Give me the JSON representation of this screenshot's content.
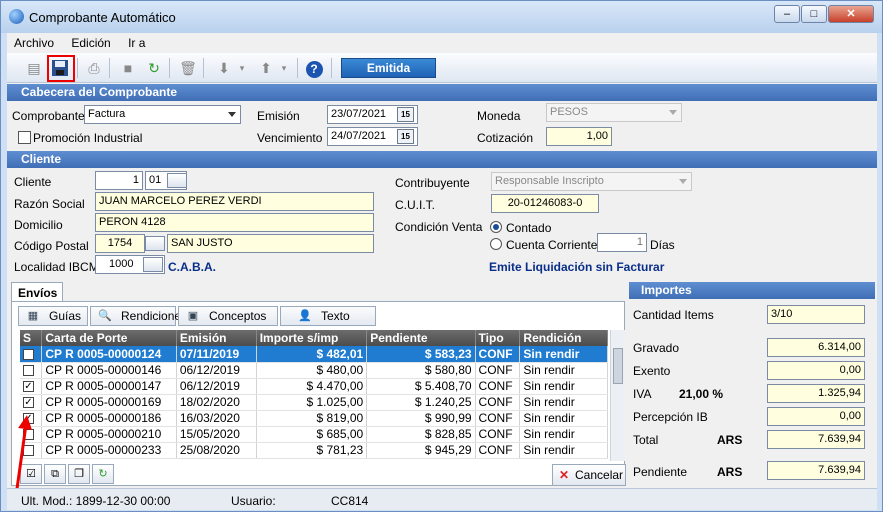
{
  "window": {
    "title": "Comprobante Automático",
    "minimize": "–",
    "maximize": "□",
    "close": "✕"
  },
  "menu": [
    "Archivo",
    "Edición",
    "Ir a"
  ],
  "toolbar": {
    "status": "Emitida",
    "help": "?"
  },
  "cabecera": {
    "header": "Cabecera del Comprobante",
    "comprobante_label": "Comprobante",
    "comprobante_value": "Factura",
    "promocion_label": "Promoción Industrial",
    "emision_label": "Emisión",
    "emision_value": "23/07/2021",
    "vencimiento_label": "Vencimiento",
    "vencimiento_value": "24/07/2021",
    "calendar_label": "15",
    "moneda_label": "Moneda",
    "moneda_value": "PESOS",
    "cotizacion_label": "Cotización",
    "cotizacion_value": "1,00"
  },
  "cliente": {
    "header": "Cliente",
    "cliente_label": "Cliente",
    "cliente_num": "1",
    "cliente_suc": "01",
    "razon_label": "Razón Social",
    "razon_value": "JUAN MARCELO PEREZ VERDI",
    "domicilio_label": "Domicilio",
    "domicilio_value": "PERON 4128",
    "cp_label": "Código Postal",
    "cp_value": "1754",
    "cp_city": "SAN JUSTO",
    "localidad_label": "Localidad IBCM",
    "localidad_code": "1000",
    "localidad_name": "C.A.B.A.",
    "contribuyente_label": "Contribuyente",
    "contribuyente_value": "Responsable Inscripto",
    "cuit_label": "C.U.I.T.",
    "cuit_value": "20-01246083-0",
    "condicion_label": "Condición Venta",
    "contado_label": "Contado",
    "cuenta_label": "Cuenta Corriente",
    "dias_value": "1",
    "dias_label": "Días",
    "emite_note": "Emite Liquidación sin Facturar"
  },
  "envios": {
    "tab": "Envíos",
    "subtabs": [
      "Guías",
      "Rendiciones",
      "Conceptos",
      "Texto"
    ],
    "columns": [
      "S",
      "Carta de Porte",
      "Emisión",
      "Importe s/imp",
      "Pendiente",
      "Tipo",
      "Rendición"
    ],
    "rows": [
      {
        "check": "",
        "carta": "CP R 0005-00000124",
        "emision": "07/11/2019",
        "importe": "$ 482,01",
        "pendiente": "$ 583,23",
        "tipo": "CONF",
        "rendicion": "Sin rendir"
      },
      {
        "check": "",
        "carta": "CP R 0005-00000146",
        "emision": "06/12/2019",
        "importe": "$ 480,00",
        "pendiente": "$ 580,80",
        "tipo": "CONF",
        "rendicion": "Sin rendir"
      },
      {
        "check": "✓",
        "carta": "CP R 0005-00000147",
        "emision": "06/12/2019",
        "importe": "$ 4.470,00",
        "pendiente": "$ 5.408,70",
        "tipo": "CONF",
        "rendicion": "Sin rendir"
      },
      {
        "check": "✓",
        "carta": "CP R 0005-00000169",
        "emision": "18/02/2020",
        "importe": "$ 1.025,00",
        "pendiente": "$ 1.240,25",
        "tipo": "CONF",
        "rendicion": "Sin rendir"
      },
      {
        "check": "✓",
        "carta": "CP R 0005-00000186",
        "emision": "16/03/2020",
        "importe": "$ 819,00",
        "pendiente": "$ 990,99",
        "tipo": "CONF",
        "rendicion": "Sin rendir"
      },
      {
        "check": "",
        "carta": "CP R 0005-00000210",
        "emision": "15/05/2020",
        "importe": "$ 685,00",
        "pendiente": "$ 828,85",
        "tipo": "CONF",
        "rendicion": "Sin rendir"
      },
      {
        "check": "",
        "carta": "CP R 0005-00000233",
        "emision": "25/08/2020",
        "importe": "$ 781,23",
        "pendiente": "$ 945,29",
        "tipo": "CONF",
        "rendicion": "Sin rendir"
      }
    ],
    "cancel_label": "Cancelar"
  },
  "importes": {
    "header": "Importes",
    "cantidad_label": "Cantidad Items",
    "cantidad_value": "3/10",
    "gravado_label": "Gravado",
    "gravado_value": "6.314,00",
    "exento_label": "Exento",
    "exento_value": "0,00",
    "iva_label": "IVA",
    "iva_rate": "21,00 %",
    "iva_value": "1.325,94",
    "percepcion_label": "Percepción IB",
    "percepcion_value": "0,00",
    "total_label": "Total",
    "total_currency": "ARS",
    "total_value": "7.639,94",
    "pendiente_label": "Pendiente",
    "pendiente_currency": "ARS",
    "pendiente_value": "7.639,94"
  },
  "status": {
    "ult_mod": "Ult. Mod.: 1899-12-30 00:00",
    "usuario_label": "Usuario:",
    "usuario_value": "CC814"
  }
}
